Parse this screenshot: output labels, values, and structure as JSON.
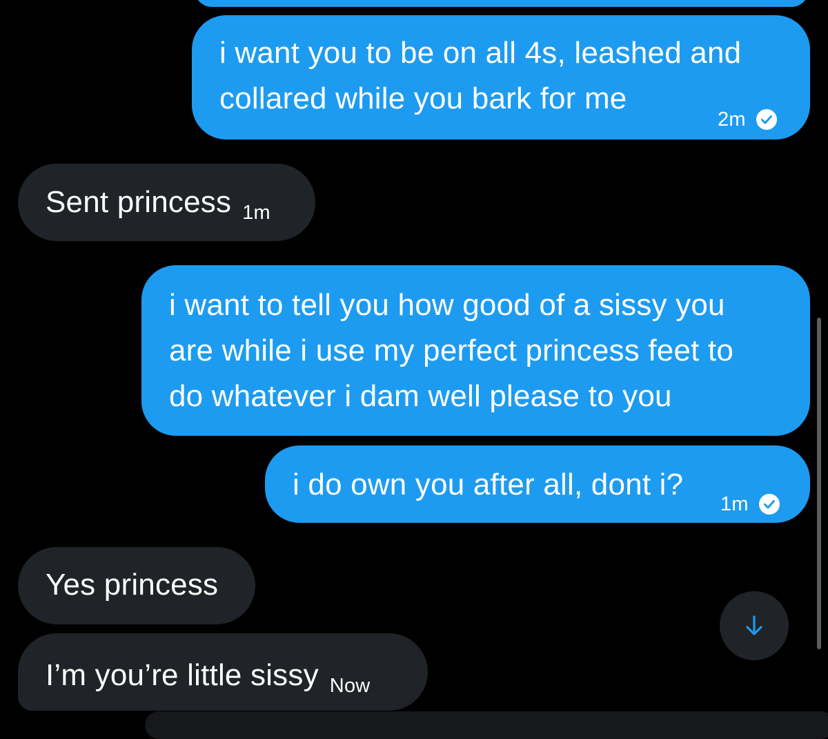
{
  "colors": {
    "background": "#000000",
    "outgoing_bubble": "#1d9bf0",
    "incoming_bubble": "#202327",
    "text": "#ffffff"
  },
  "messages": [
    {
      "direction": "outgoing",
      "text": "i want you to be on all 4s, leashed and\ncollared while you bark for me",
      "time": "2m",
      "status_icon": "check-circle-icon"
    },
    {
      "direction": "incoming",
      "text": "Sent princess",
      "time": "1m"
    },
    {
      "direction": "outgoing",
      "text": "i want to tell you how good of a sissy you\nare while i use my perfect princess feet to\ndo whatever i dam well please to you"
    },
    {
      "direction": "outgoing",
      "text": "i do own you after all, dont i?",
      "time": "1m",
      "status_icon": "check-circle-icon"
    },
    {
      "direction": "incoming",
      "text": "Yes princess"
    },
    {
      "direction": "incoming",
      "text": "I’m you’re little sissy",
      "time": "Now"
    }
  ],
  "scroll_down_button": {
    "icon": "arrow-down-icon"
  }
}
